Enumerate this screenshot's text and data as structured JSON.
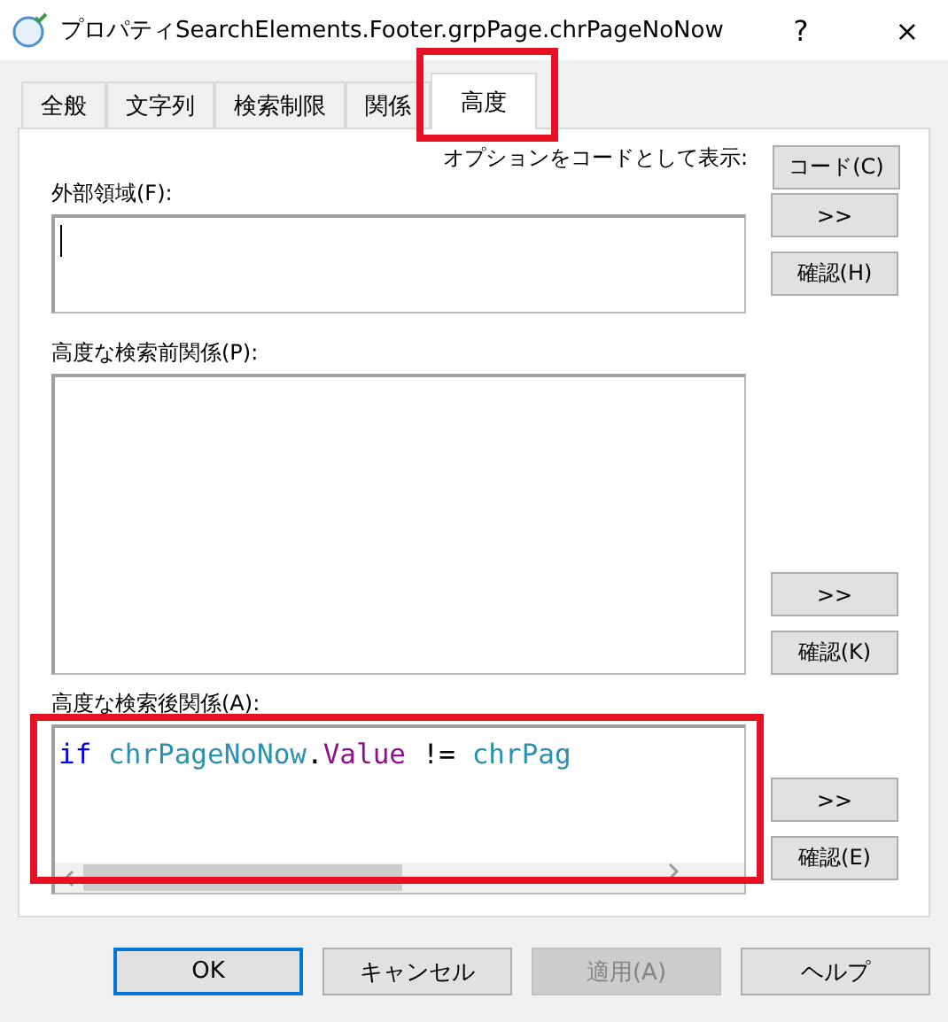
{
  "window": {
    "title": "プロパティSearchElements.Footer.grpPage.chrPageNoNow",
    "help": "?",
    "close": "×"
  },
  "tabs": [
    {
      "label": "全般",
      "selected": false,
      "highlighted": false
    },
    {
      "label": "文字列",
      "selected": false,
      "highlighted": false
    },
    {
      "label": "検索制限",
      "selected": false,
      "highlighted": false
    },
    {
      "label": "関係",
      "selected": false,
      "highlighted": false
    },
    {
      "label": "高度",
      "selected": true,
      "highlighted": true
    }
  ],
  "code_option": {
    "label": "オプションをコードとして表示:",
    "button": "コード(C)"
  },
  "sections": [
    {
      "label": "外部領域(F):",
      "focused": true,
      "highlighted": false,
      "scrollbar": false,
      "buttons": [
        ">>",
        "確認(H)"
      ]
    },
    {
      "label": "高度な検索前関係(P):",
      "focused": false,
      "highlighted": false,
      "scrollbar": false,
      "buttons": [
        ">>",
        "確認(K)"
      ]
    },
    {
      "label": "高度な検索後関係(A):",
      "focused": false,
      "highlighted": true,
      "scrollbar": true,
      "buttons": [
        ">>",
        "確認(E)"
      ],
      "code": [
        {
          "text": "if ",
          "kind": "keyword"
        },
        {
          "text": "chrPageNoNow",
          "kind": "identifier"
        },
        {
          "text": ".",
          "kind": "operator"
        },
        {
          "text": "Value",
          "kind": "property"
        },
        {
          "text": " != ",
          "kind": "operator"
        },
        {
          "text": "chrPag",
          "kind": "identifier"
        }
      ]
    }
  ],
  "buttons": [
    {
      "label": "OK",
      "default": true,
      "disabled": false
    },
    {
      "label": "キャンセル",
      "default": false,
      "disabled": false
    },
    {
      "label": "適用(A)",
      "default": false,
      "disabled": true
    },
    {
      "label": "ヘルプ",
      "default": false,
      "disabled": false
    }
  ]
}
